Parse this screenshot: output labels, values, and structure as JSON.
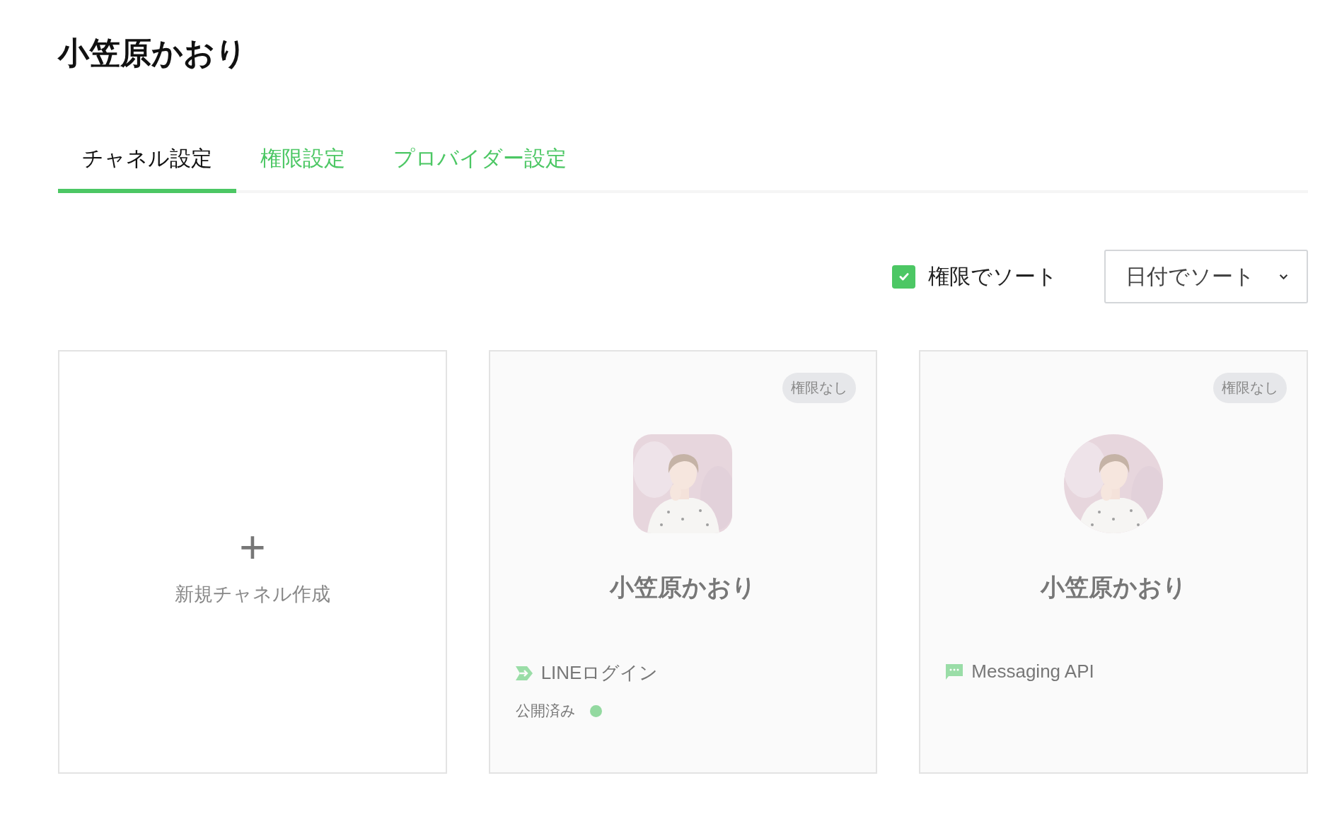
{
  "title": "小笠原かおり",
  "tabs": [
    {
      "label": "チャネル設定",
      "selected": true
    },
    {
      "label": "権限設定",
      "selected": false
    },
    {
      "label": "プロバイダー設定",
      "selected": false
    }
  ],
  "sort_by_permission": {
    "label": "権限でソート",
    "checked": true
  },
  "sort_dropdown": {
    "value": "日付でソート"
  },
  "cards": [
    {
      "kind": "create",
      "icon": "+",
      "label": "新規チャネル作成"
    },
    {
      "kind": "login",
      "disabled": true,
      "badge": "権限なし",
      "name": "小笠原かおり",
      "type_label": "LINEログイン",
      "status": {
        "label": "公開済み",
        "color": "#93d9a0"
      }
    },
    {
      "kind": "messaging",
      "disabled": true,
      "badge": "権限なし",
      "name": "小笠原かおり",
      "type_label": "Messaging API"
    }
  ]
}
